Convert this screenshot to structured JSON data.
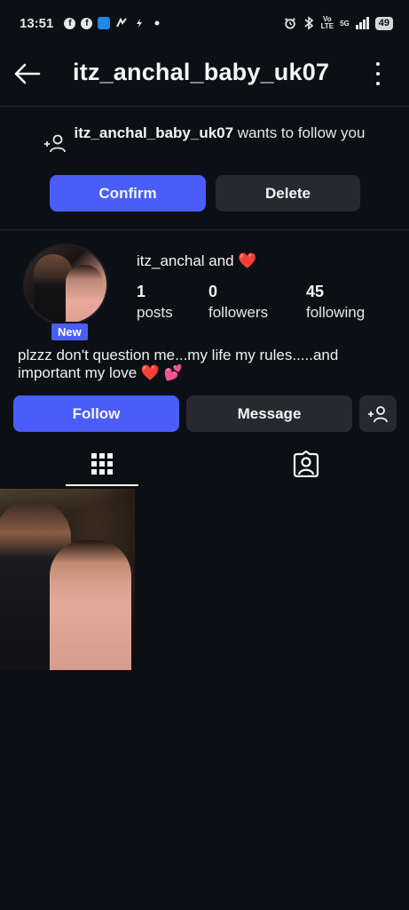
{
  "status_bar": {
    "time": "13:51",
    "network": "5G",
    "volte": "Vo\nLTE",
    "battery": "49"
  },
  "header": {
    "title": "itz_anchal_baby_uk07"
  },
  "follow_request": {
    "username": "itz_anchal_baby_uk07",
    "message": " wants to follow you",
    "confirm_label": "Confirm",
    "delete_label": "Delete"
  },
  "profile": {
    "display_name": "itz_anchal and ❤️",
    "new_badge": "New",
    "stats": [
      {
        "value": "1",
        "label": "posts"
      },
      {
        "value": "0",
        "label": "followers"
      },
      {
        "value": "45",
        "label": "following"
      }
    ],
    "bio": "plzzz don't question me...my life my rules.....and important my love ❤️ 💕"
  },
  "actions": {
    "follow_label": "Follow",
    "message_label": "Message"
  },
  "tabs": [
    {
      "icon": "grid-icon",
      "active": true
    },
    {
      "icon": "tagged-icon",
      "active": false
    }
  ],
  "colors": {
    "background": "#0c1014",
    "accent": "#4a5df9",
    "secondary_button": "#262a30"
  }
}
